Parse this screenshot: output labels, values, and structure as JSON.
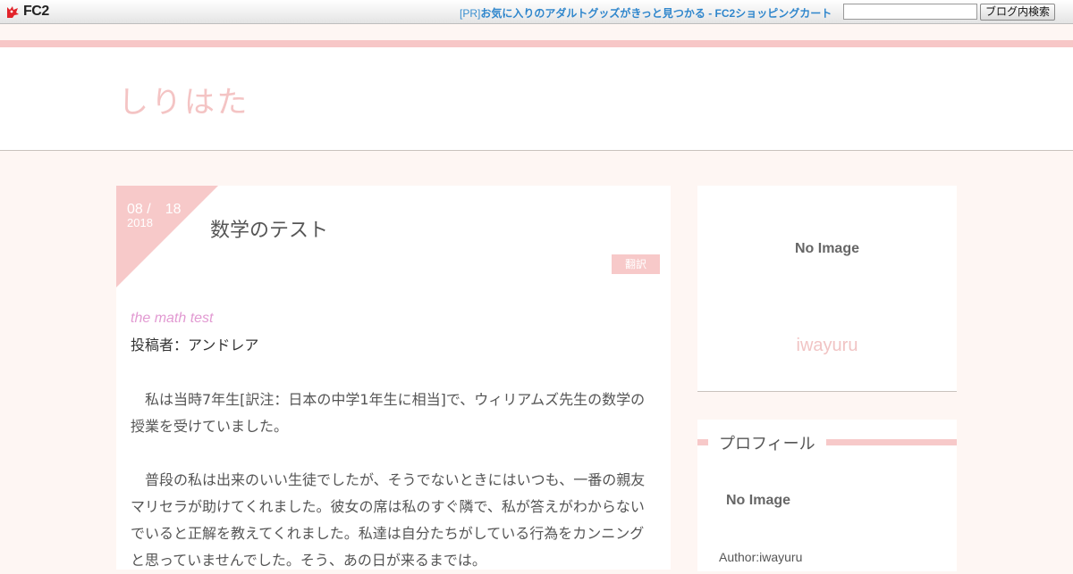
{
  "fc2bar": {
    "logo_text": "FC2",
    "pr_tag": "[PR]",
    "pr_text": "お気に入りのアダルトグッズがきっと見つかる - FC2ショッピングカート",
    "search_placeholder": "",
    "search_button": "ブログ内検索"
  },
  "header": {
    "blog_title": "しりはた"
  },
  "article": {
    "date_md": "08 /　18",
    "date_year": "2018",
    "title": "数学のテスト",
    "category": "翻訳",
    "en_title": "the math test",
    "author": "投稿者：アンドレア",
    "paragraphs": [
      "　私は当時7年生[訳注：日本の中学1年生に相当]で、ウィリアムズ先生の数学の授業を受けていました。",
      "　普段の私は出来のいい生徒でしたが、そうでないときにはいつも、一番の親友マリセラが助けてくれました。彼女の席は私のすぐ隣で、私が答えがわからないでいると正解を教えてくれました。私達は自分たちがしている行為をカンニングと思っていませんでした。そう、あの日が来るまでは。"
    ]
  },
  "sidebar": {
    "top_noimage": "No Image",
    "nickname": "iwayuru",
    "profile_title": "プロフィール",
    "profile_noimage": "No Image",
    "author_line": "Author:iwayuru"
  },
  "colors": {
    "accent_pink": "#f7c9c9",
    "link_blue": "#2f86cc",
    "title_pink": "#f4c4c4"
  }
}
